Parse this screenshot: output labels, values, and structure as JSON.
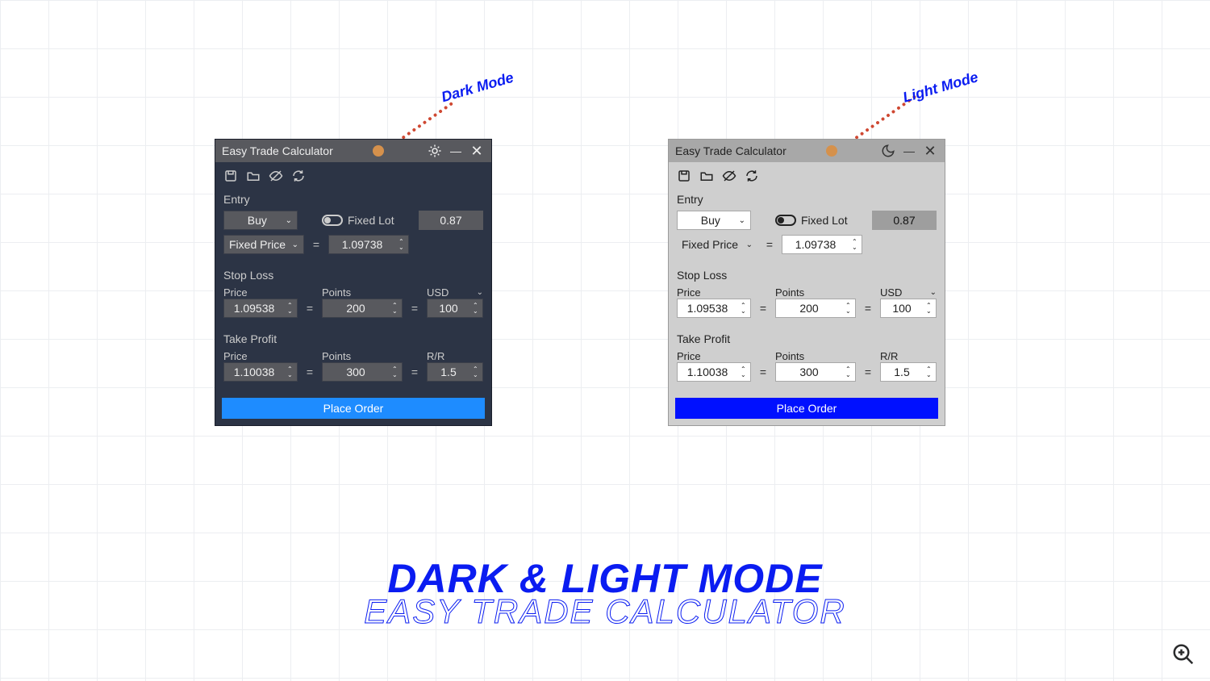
{
  "annotations": {
    "dark": "Dark Mode",
    "light": "Light Mode"
  },
  "headline": {
    "line1": "DARK & LIGHT MODE",
    "line2": "EASY TRADE CALCULATOR"
  },
  "panel": {
    "title": "Easy Trade Calculator",
    "entry": {
      "label": "Entry",
      "side": "Buy",
      "price_mode": "Fixed Price",
      "price": "1.09738",
      "lot_mode": "Fixed Lot",
      "lot": "0.87"
    },
    "stoploss": {
      "label": "Stop Loss",
      "price_lbl": "Price",
      "points_lbl": "Points",
      "currency_lbl": "USD",
      "price": "1.09538",
      "points": "200",
      "value": "100"
    },
    "takeprofit": {
      "label": "Take Profit",
      "price_lbl": "Price",
      "points_lbl": "Points",
      "rr_lbl": "R/R",
      "price": "1.10038",
      "points": "300",
      "rr": "1.5"
    },
    "place_order": "Place Order"
  }
}
